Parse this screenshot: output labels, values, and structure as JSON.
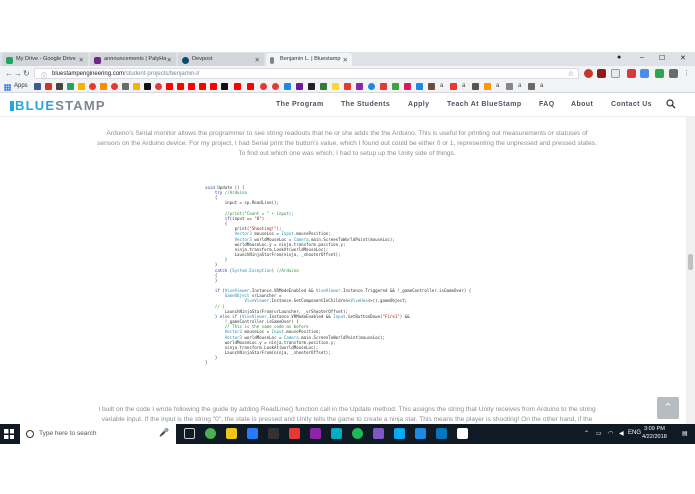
{
  "browser": {
    "tabs": [
      {
        "label": "My Drive - Google Drive",
        "favicon_color": "#1fa463"
      },
      {
        "label": "announcements | PalyHa",
        "favicon_color": "#6e2a82"
      },
      {
        "label": "Devpost",
        "favicon_color": "#0b4a6e"
      },
      {
        "label": "Benjamin L. | Bluestamp",
        "favicon_color": "#7d8792"
      }
    ],
    "url_host": "bluestampengineering.com",
    "url_path": "/student-projects/benjamin-l/",
    "bookmarks_apps_label": "Apps",
    "bookmark_text": "a"
  },
  "site": {
    "logo": "BLUESTAMP",
    "logo_blue_part": "BLUE",
    "logo_grey_part": "STAMP",
    "nav": [
      {
        "label": "The Program"
      },
      {
        "label": "The Students"
      },
      {
        "label": "Apply"
      },
      {
        "label": "Teach At BlueStamp"
      },
      {
        "label": "FAQ"
      },
      {
        "label": "About"
      },
      {
        "label": "Contact Us"
      }
    ]
  },
  "content": {
    "para1": "Arduino's Serial monitor allows the programmer to see string readouts that he or she adds the the Arduino. This is useful for printing out measurements or statuses of sensors on the Arduino device. For my project, I had Serial print the button's value, which I found out could be either 0 or 1, representing the unpressed and pressed states. To find out which one was which, I had to setup up the Unity side of things.",
    "para2": "I built on the code I wrote following the guide by adding ReadLine() function call in the Update method. This assigns the string that Unity receives from Arduino to the string variable input. If the input is the string \"0\", the state is pressed and Unity tells the game to create a ninja star. This means the player is shooting! On the other hand, if the button is",
    "code": [
      "void Update () {",
      "    try //Arduino",
      "    {",
      "        input = sp.ReadLine();",
      "",
      "        //print(\"Count = \" + input);",
      "        if(input == \"0\")",
      "        {",
      "            print(\"Shooting!\");",
      "            Vector3 mouseLoc = Input.mousePosition;",
      "            Vector3 worldMouseLoc = Camera.main.ScreenToWorldPoint(mouseLoc);",
      "            worldMouseLoc.y = ninja.transform.position.y;",
      "            ninja.transform.LookAt(worldMouseLoc);",
      "            LaunchNinjaStarFrom(ninja, _shooterOffset);",
      "        }",
      "    }",
      "    catch (System.Exception) //Arduino",
      "    {",
      "    }",
      "",
      "    if (ViveViewer.Instance.VRModeEnabled && ViveViewer.Instance.Triggered && !_gameController.isGameOver) {",
      "        GameObject vrLauncher =",
      "                ViveViewer.Instance.GetComponentInChildren<ViveHead>().gameObject;",
      "    // }",
      "        LaunchNinjaStarFrom(vrLauncher, _vrShooterOffset);",
      "    } else if (ViveViewer.Instance.VRModeEnabled && Input.GetButtonDown(\"Fire1\") &&",
      "        !_gameController.isGameOver) {",
      "        // This is the same code as before",
      "        Vector3 mouseLoc = Input.mousePosition;",
      "        Vector3 worldMouseLoc = Camera.main.ScreenToWorldPoint(mouseLoc);",
      "        worldMouseLoc.y = ninja.transform.position.y;",
      "        ninja.transform.LookAt(worldMouseLoc);",
      "        LaunchNinjaStarFrom(ninja, _shooterOffset);",
      "    }",
      "}"
    ]
  },
  "taskbar": {
    "search_placeholder": "Type here to search",
    "language": "ENG",
    "time": "3:09 PM",
    "date": "4/22/2018"
  }
}
